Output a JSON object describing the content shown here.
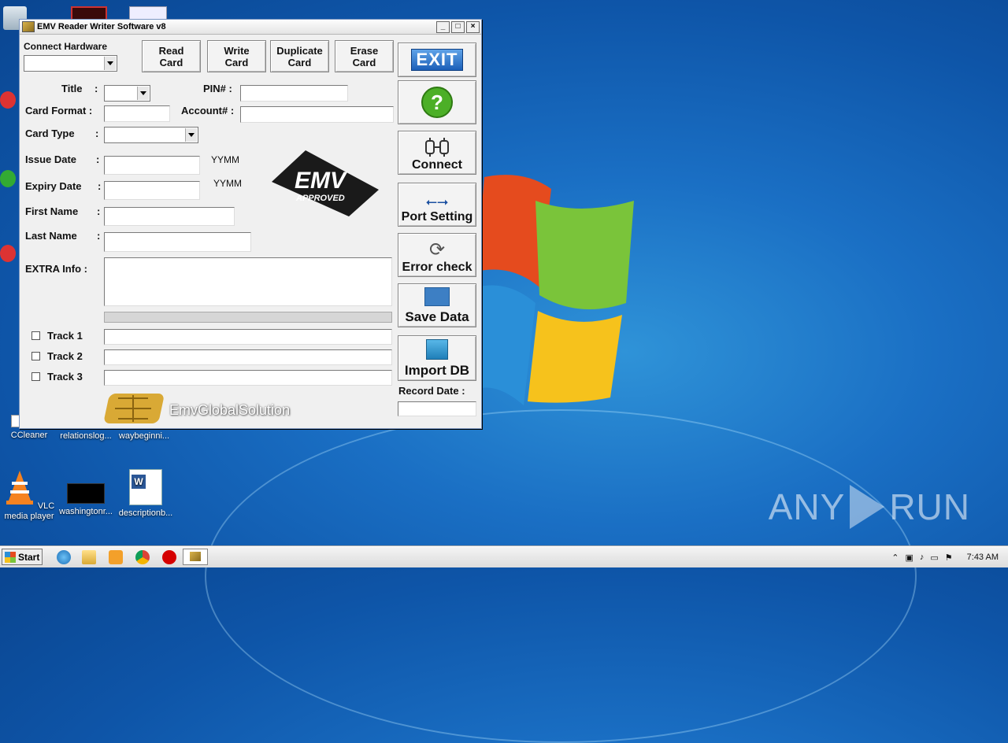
{
  "window": {
    "title": "EMV Reader Writer Software v8",
    "min": "_",
    "max": "□",
    "close": "×"
  },
  "connect_hardware": {
    "label": "Connect Hardware",
    "value": ""
  },
  "top_buttons": {
    "read": "Read\nCard",
    "write": "Write\nCard",
    "duplicate": "Duplicate\nCard",
    "erase": "Erase\nCard"
  },
  "form": {
    "title_label": "Title",
    "pin_label": "PIN# :",
    "card_format_label": "Card Format :",
    "account_label": "Account# :",
    "card_type_label": "Card Type",
    "issue_date_label": "Issue Date",
    "expiry_date_label": "Expiry Date",
    "date_hint_1": "YYMM",
    "date_hint_2": "YYMM",
    "first_name_label": "First Name",
    "last_name_label": "Last Name",
    "extra_info_label": "EXTRA Info :",
    "colon": ":",
    "track1": "Track 1",
    "track2": "Track 2",
    "track3": "Track 3"
  },
  "emv_logo": {
    "line1": "EMV",
    "line2": "APPROVED"
  },
  "footer_brand": "EmvGlobalSolution",
  "side_buttons": {
    "exit": "EXIT",
    "connect": "Connect",
    "port_setting": "Port Setting",
    "error_check": "Error check",
    "save_data": "Save Data",
    "import_db": "Import DB"
  },
  "record_date_label": "Record Date :",
  "desktop_icons": {
    "ccleaner": "CCleaner",
    "relationslog": "relationslog...",
    "waybeginni": "waybeginni...",
    "vlc": "VLC media player",
    "washington": "washingtonr...",
    "description": "descriptionb..."
  },
  "taskbar": {
    "start": "Start",
    "time": "7:43 AM"
  },
  "watermark": {
    "left": "ANY",
    "right": "RUN"
  }
}
